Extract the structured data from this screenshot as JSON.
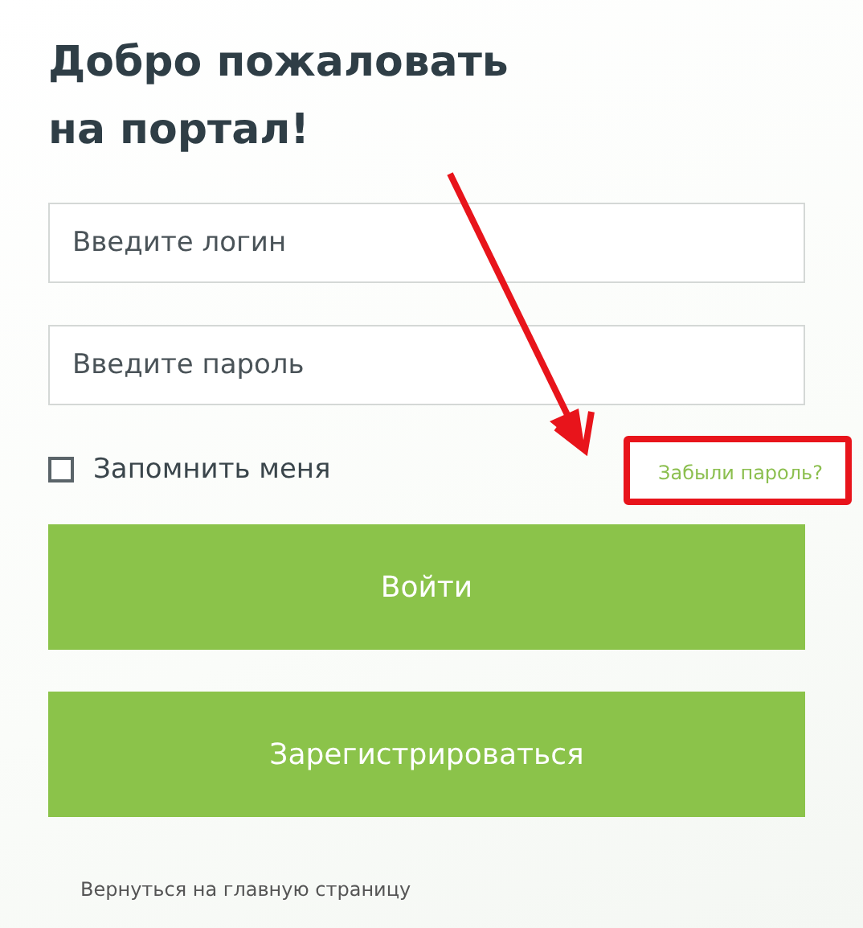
{
  "title_lines": [
    "Добро пожаловать",
    "на портал!"
  ],
  "login": {
    "placeholder": "Введите логин"
  },
  "password": {
    "placeholder": "Введите пароль"
  },
  "remember": {
    "label": "Запомнить меня",
    "checked": false
  },
  "forgot_link": "Забыли пароль?",
  "buttons": [
    "Войти",
    "Зарегистрироваться"
  ],
  "back_link": "Вернуться на главную страницу"
}
